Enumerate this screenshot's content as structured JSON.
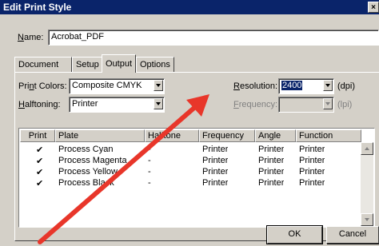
{
  "window": {
    "title": "Edit Print Style",
    "close_glyph": "×"
  },
  "name": {
    "label_u": "N",
    "label_rest": "ame:",
    "value": "Acrobat_PDF"
  },
  "tabs": [
    {
      "label": "Document",
      "active": false
    },
    {
      "label": "Setup",
      "active": false
    },
    {
      "label": "Output",
      "active": true
    },
    {
      "label": "Options",
      "active": false
    }
  ],
  "output": {
    "print_colors": {
      "label_pre": "Pri",
      "label_u": "n",
      "label_rest": "t Colors:",
      "value": "Composite CMYK"
    },
    "halftoning": {
      "label_u": "H",
      "label_rest": "alftoning:",
      "value": "Printer"
    },
    "resolution": {
      "label_u": "R",
      "label_rest": "esolution:",
      "value": "2400",
      "unit": "(dpi)"
    },
    "frequency": {
      "label_u": "F",
      "label_rest": "requency:",
      "value": "",
      "unit": "(lpi)",
      "enabled": false
    }
  },
  "plates_table": {
    "columns": [
      "Print",
      "Plate",
      "Halftone",
      "Frequency",
      "Angle",
      "Function"
    ],
    "rows": [
      {
        "print": "✔",
        "plate": "Process Cyan",
        "halftone": "-",
        "frequency": "Printer",
        "angle": "Printer",
        "function": "Printer"
      },
      {
        "print": "✔",
        "plate": "Process Magenta",
        "halftone": "-",
        "frequency": "Printer",
        "angle": "Printer",
        "function": "Printer"
      },
      {
        "print": "✔",
        "plate": "Process Yellow",
        "halftone": "-",
        "frequency": "Printer",
        "angle": "Printer",
        "function": "Printer"
      },
      {
        "print": "✔",
        "plate": "Process Black",
        "halftone": "-",
        "frequency": "Printer",
        "angle": "Printer",
        "function": "Printer"
      }
    ]
  },
  "buttons": {
    "ok": "OK",
    "cancel": "Cancel"
  },
  "annotation": {
    "arrow_color": "#e8362a"
  }
}
